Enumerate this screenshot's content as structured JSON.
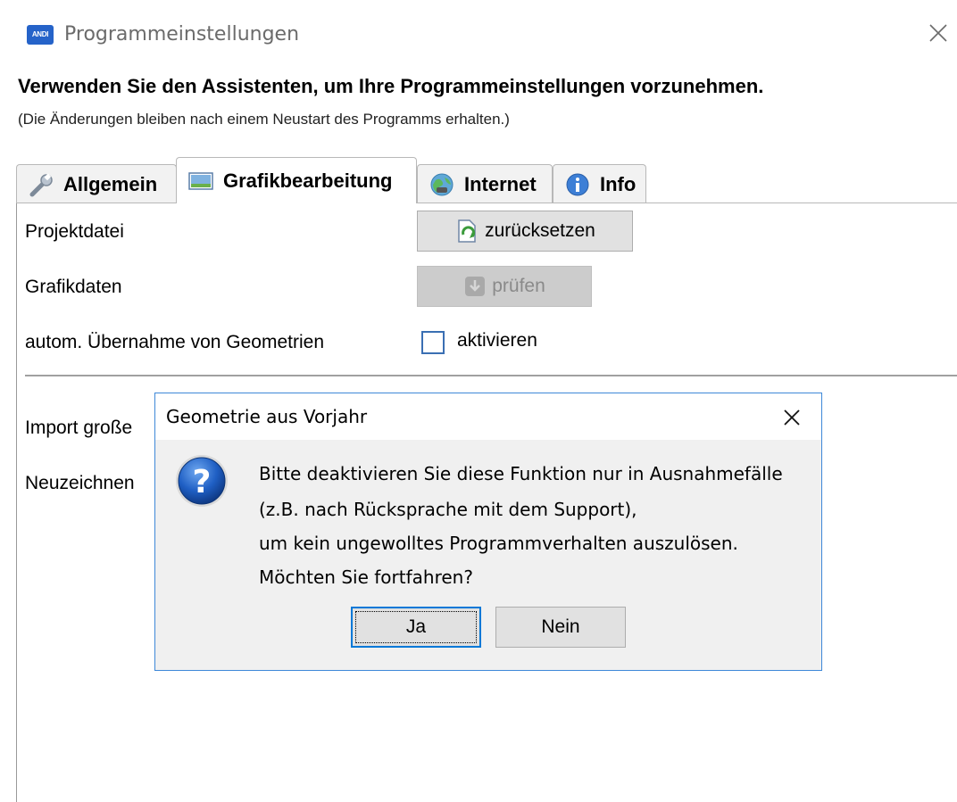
{
  "window": {
    "app_icon_text": "ANDI",
    "title": "Programmeinstellungen"
  },
  "headline": "Verwenden Sie den Assistenten, um Ihre Programmeinstellungen vorzunehmen.",
  "subline": "(Die Änderungen bleiben nach einem Neustart des Programms erhalten.)",
  "tabs": [
    {
      "label": "Allgemein",
      "icon": "wrench-icon",
      "active": false
    },
    {
      "label": "Grafikbearbeitung",
      "icon": "image-icon",
      "active": true
    },
    {
      "label": "Internet",
      "icon": "globe-icon",
      "active": false
    },
    {
      "label": "Info",
      "icon": "info-icon",
      "active": false
    }
  ],
  "settings": {
    "project_file_label": "Projektdatei",
    "reset_button": "zurücksetzen",
    "graphic_data_label": "Grafikdaten",
    "check_button": "prüfen",
    "auto_adopt_label": "autom. Übernahme von Geometrien",
    "auto_adopt_checkbox_label": "aktivieren",
    "auto_adopt_checked": false,
    "import_label": "Import große",
    "redraw_label": "Neuzeichnen"
  },
  "dialog": {
    "title": "Geometrie aus Vorjahr",
    "icon": "question-icon",
    "lines": [
      "Bitte deaktivieren Sie diese Funktion nur in Ausnahmefälle",
      "(z.B. nach Rücksprache mit dem Support),",
      "um kein ungewolltes Programmverhalten auszulösen.",
      "Möchten Sie fortfahren?"
    ],
    "yes_button": "Ja",
    "no_button": "Nein"
  },
  "colors": {
    "accent": "#0078d7",
    "dialog_border": "#3e88d8",
    "app_icon": "#2563c9"
  }
}
